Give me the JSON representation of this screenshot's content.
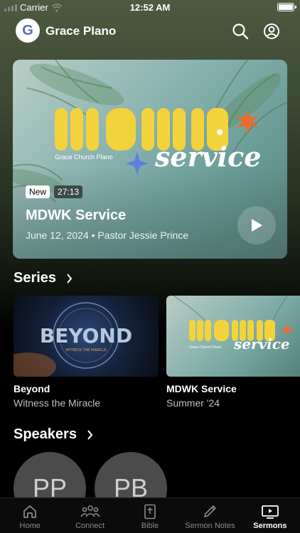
{
  "status_bar": {
    "carrier": "Carrier",
    "time": "12:52 AM"
  },
  "header": {
    "logo_letter": "G",
    "title": "Grace Plano",
    "icons": [
      "search-icon",
      "profile-icon"
    ]
  },
  "featured": {
    "artwork_title": "MDWK",
    "artwork_script": "service",
    "artwork_caption": "Grace Church Plano",
    "badge_new": "New",
    "duration": "27:13",
    "title": "MDWK Service",
    "subtitle": "June 12, 2024 • Pastor Jessie Prince"
  },
  "series_section": {
    "title": "Series",
    "items": [
      {
        "title": "Beyond",
        "subtitle": "Witness the Miracle",
        "art_word": "BEYOND",
        "art_small": "WITNESS THE MIRACLE"
      },
      {
        "title": "MDWK Service",
        "subtitle": "Summer '24",
        "art_word": "MDWK",
        "art_script": "service",
        "art_caption": "Grace Church Plano"
      }
    ]
  },
  "speakers_section": {
    "title": "Speakers",
    "items": [
      {
        "initials": "PP"
      },
      {
        "initials": "PB"
      }
    ]
  },
  "tabs": [
    {
      "label": "Home",
      "icon": "home-icon",
      "active": false
    },
    {
      "label": "Connect",
      "icon": "people-icon",
      "active": false
    },
    {
      "label": "Bible",
      "icon": "bible-icon",
      "active": false
    },
    {
      "label": "Sermon Notes",
      "icon": "pencil-icon",
      "active": false
    },
    {
      "label": "Sermons",
      "icon": "tv-play-icon",
      "active": true
    }
  ],
  "colors": {
    "accent_yellow": "#f2d33c",
    "accent_orange": "#f06a2a",
    "accent_blue": "#5f7fe0"
  }
}
